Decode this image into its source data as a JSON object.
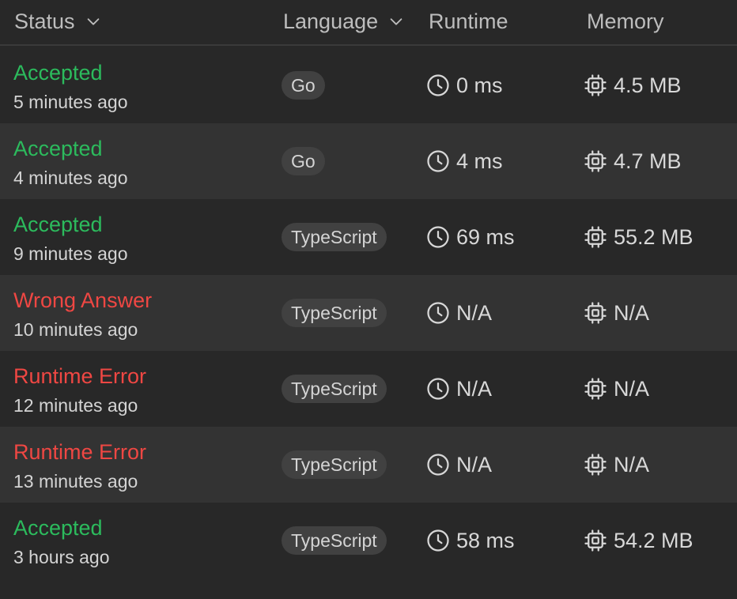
{
  "header": {
    "status": "Status",
    "language": "Language",
    "runtime": "Runtime",
    "memory": "Memory"
  },
  "colors": {
    "accepted": "#2cbb5d",
    "error": "#ef4743",
    "background": "#282828",
    "row_alt": "#333333",
    "pill": "#414141"
  },
  "icons": {
    "runtime": "clock-icon",
    "memory": "cpu-chip-icon",
    "sort": "chevron-down-icon"
  },
  "rows": [
    {
      "status": "Accepted",
      "kind": "ok",
      "time": "5 minutes ago",
      "language": "Go",
      "runtime": "0 ms",
      "memory": "4.5 MB"
    },
    {
      "status": "Accepted",
      "kind": "ok",
      "time": "4 minutes ago",
      "language": "Go",
      "runtime": "4 ms",
      "memory": "4.7 MB"
    },
    {
      "status": "Accepted",
      "kind": "ok",
      "time": "9 minutes ago",
      "language": "TypeScript",
      "runtime": "69 ms",
      "memory": "55.2 MB"
    },
    {
      "status": "Wrong Answer",
      "kind": "bad",
      "time": "10 minutes ago",
      "language": "TypeScript",
      "runtime": "N/A",
      "memory": "N/A"
    },
    {
      "status": "Runtime Error",
      "kind": "bad",
      "time": "12 minutes ago",
      "language": "TypeScript",
      "runtime": "N/A",
      "memory": "N/A"
    },
    {
      "status": "Runtime Error",
      "kind": "bad",
      "time": "13 minutes ago",
      "language": "TypeScript",
      "runtime": "N/A",
      "memory": "N/A"
    },
    {
      "status": "Accepted",
      "kind": "ok",
      "time": "3 hours ago",
      "language": "TypeScript",
      "runtime": "58 ms",
      "memory": "54.2 MB"
    }
  ]
}
